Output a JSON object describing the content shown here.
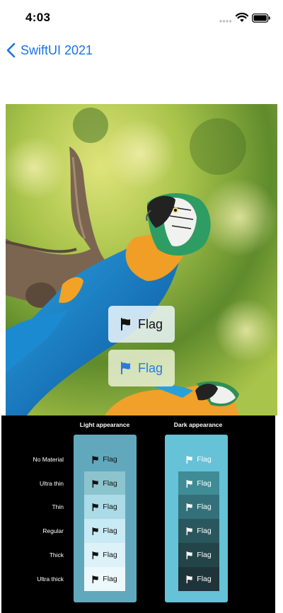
{
  "status_bar": {
    "time": "4:03"
  },
  "nav": {
    "back_label": "SwiftUI 2021"
  },
  "overlay_buttons": [
    {
      "label": "Flag",
      "style": "light",
      "icon": "flag-icon"
    },
    {
      "label": "Flag",
      "style": "tinted",
      "icon": "flag-icon"
    }
  ],
  "materials_table": {
    "columns": [
      "Light appearance",
      "Dark appearance"
    ],
    "rows": [
      "No Material",
      "Ultra thin",
      "Thin",
      "Regular",
      "Thick",
      "Ultra thick"
    ],
    "cell_label": "Flag",
    "light_cell_colors": [
      "#62a8bd",
      "#8cc4ce",
      "#aadbe7",
      "#c8eaf4",
      "#dcf2f8",
      "#ecf8fb"
    ],
    "dark_cell_colors": [
      "#66c2d6",
      "#3f8c96",
      "#33707a",
      "#2a575d",
      "#234448",
      "#1e3438"
    ]
  },
  "colors": {
    "accent": "#1a73e8",
    "flag_tint": "#2a7ae2"
  }
}
